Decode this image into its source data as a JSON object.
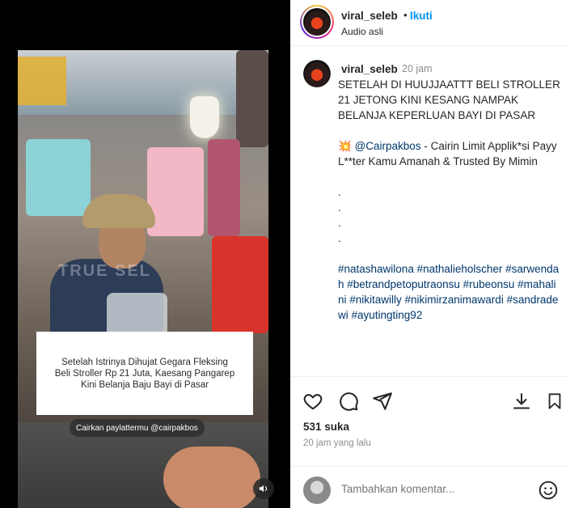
{
  "header": {
    "username": "viral_seleb",
    "separator": "•",
    "follow_label": "Ikuti",
    "audio_label": "Audio asli",
    "accent_color": "#0095f6"
  },
  "video": {
    "caption_lines": [
      "Setelah Istrinya Dihujat Gegara Fleksing",
      "Beli Stroller Rp 21 Juta, Kaesang Pangarep",
      "Kini Belanja Baju Bayi di Pasar"
    ],
    "promo_text": "Cairkan paylattermu @cairpakbos",
    "watermark": "TRUE SEL",
    "sound_icon": "speaker-icon"
  },
  "post": {
    "username": "viral_seleb",
    "time": "20 jam",
    "caption_main": "SETELAH DI HUUJJAATTT BELI STROLLER 21 JETONG KINI KESANG NAMPAK BELANJA KEPERLUAN BAYI DI PASAR",
    "promo_emoji": "💥",
    "promo_mention": "@Cairpakbos",
    "promo_text": " - Cairin Limit Applik*si Payy L**ter Kamu Amanah & Trusted By Mimin",
    "dots": [
      ".",
      ".",
      ".",
      "."
    ],
    "hashtags": "#natashawilona #nathalieholscher #sarwendah #betrandpetoputraonsu #rubeonsu #mahalini #nikitawilly #nikimirzanimawardi #sandradewi #ayutingting92"
  },
  "actions": {
    "likes": "531 suka",
    "ago": "20 jam yang lalu",
    "icons": [
      "heart-icon",
      "comment-icon",
      "share-icon",
      "download-icon",
      "bookmark-icon"
    ]
  },
  "comment_box": {
    "placeholder": "Tambahkan komentar...",
    "emoji_icon": "smiley-icon"
  }
}
